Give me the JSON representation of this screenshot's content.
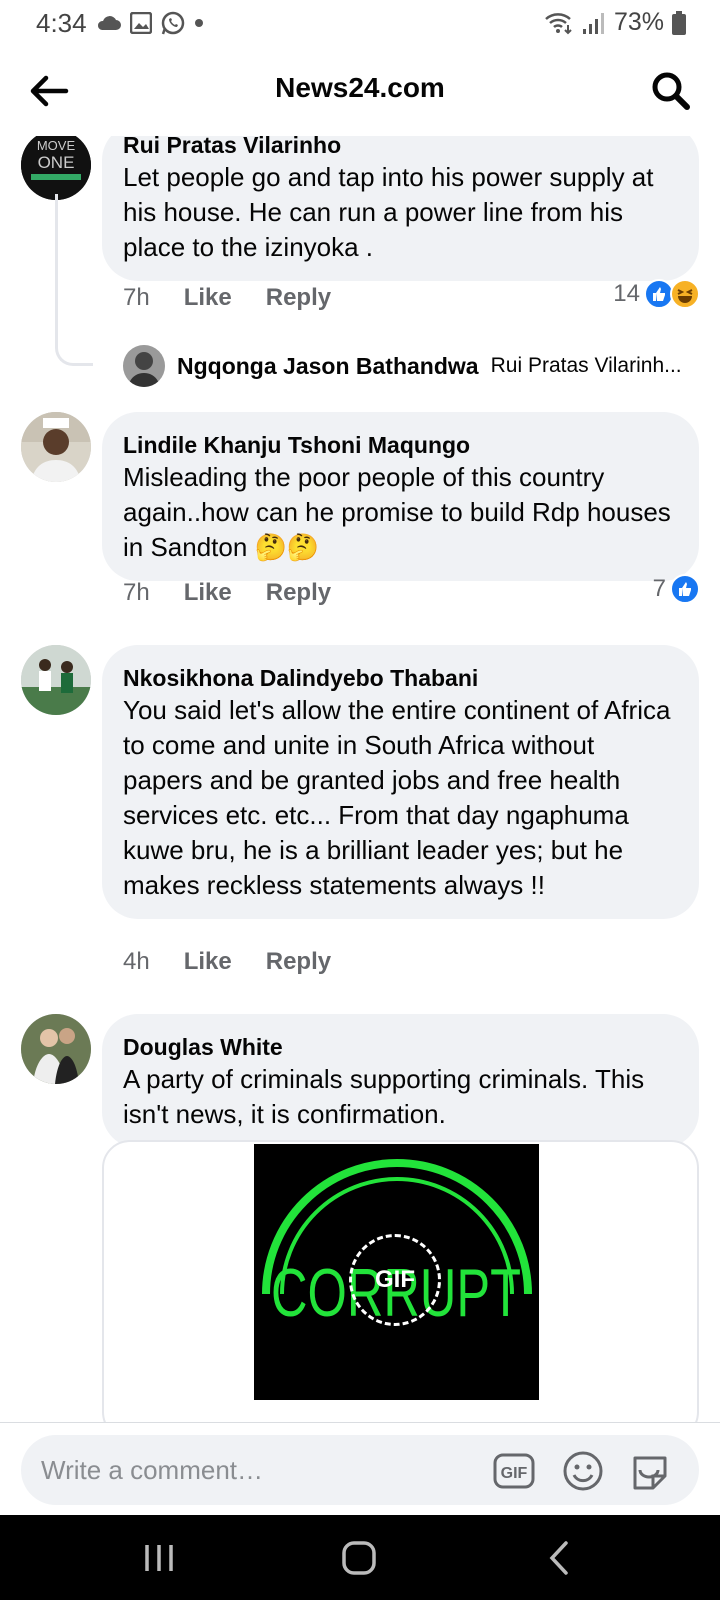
{
  "status_bar": {
    "time": "4:34",
    "battery": "73%",
    "icons": [
      "cloud-icon",
      "gallery-icon",
      "whatsapp-icon",
      "dot-icon",
      "wifi-icon",
      "signal-icon",
      "battery-icon"
    ]
  },
  "header": {
    "title": "News24.com",
    "back_icon": "arrow-left-icon",
    "search_icon": "search-icon"
  },
  "comments": [
    {
      "author": "Rui Pratas Vilarinho",
      "text": "Let people go and tap into his power supply at his house.  He can run a power line from his place to the izinyoka .",
      "time": "7h",
      "like_label": "Like",
      "reply_label": "Reply",
      "reaction_count": "14",
      "reactions": [
        "like",
        "haha"
      ],
      "avatar_text": [
        "MOVE",
        "ONE"
      ],
      "reply": {
        "author": "Ngqonga Jason Bathandwa",
        "preview": "Rui Pratas Vilarinh..."
      }
    },
    {
      "author": "Lindile Khanju Tshoni Maqungo",
      "text": "Misleading the poor people of this country again..how can he promise to build Rdp houses in Sandton 🤔🤔",
      "time": "7h",
      "like_label": "Like",
      "reply_label": "Reply",
      "reaction_count": "7",
      "reactions": [
        "like"
      ]
    },
    {
      "author": "Nkosikhona Dalindyebo Thabani",
      "text": "You said let's allow the entire continent of Africa to come and unite in South Africa without papers and be granted jobs and free health services etc. etc... From that day ngaphuma kuwe bru, he is a brilliant leader yes; but he makes reckless statements always !!",
      "time": "4h",
      "like_label": "Like",
      "reply_label": "Reply"
    },
    {
      "author": "Douglas White",
      "text": "A party of criminals supporting criminals. This isn't news, it is confirmation.",
      "gif": {
        "badge": "GIF",
        "image_text": "CORRUPT"
      }
    }
  ],
  "composer": {
    "placeholder": "Write a comment…",
    "gif_icon": "gif-icon",
    "emoji_icon": "emoji-icon",
    "sticker_icon": "sticker-icon"
  },
  "nav_bar": {
    "icons": [
      "recent-apps-icon",
      "home-icon",
      "back-icon"
    ]
  },
  "colors": {
    "bubble": "#f0f2f5",
    "like_blue": "#1877f2",
    "meta_gray": "#65676b",
    "corrupt_green": "#22e33a"
  }
}
